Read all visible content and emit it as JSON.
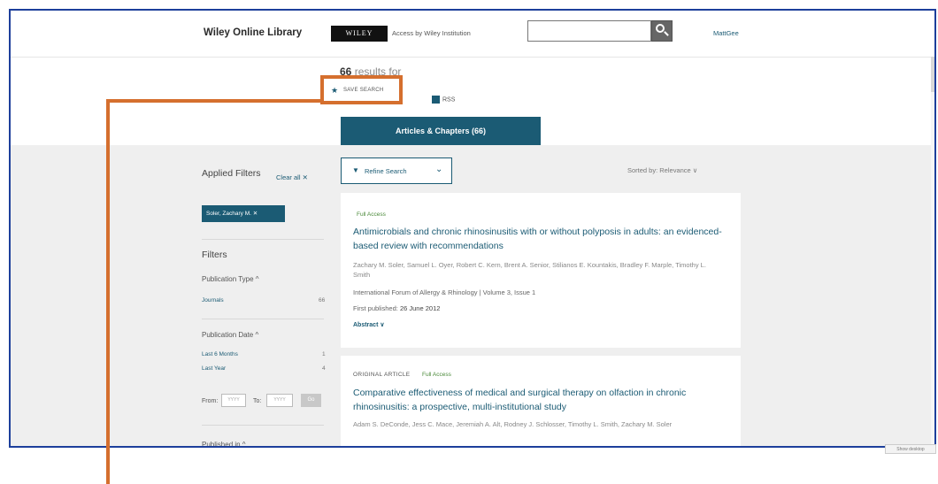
{
  "header": {
    "logo": "Wiley Online Library",
    "wiley_badge": "WILEY",
    "access_text": "Access by Wiley Institution",
    "search_placeholder": "",
    "user": "MattGee"
  },
  "results": {
    "count": "66",
    "label": " results for",
    "save_search": "SAVE SEARCH",
    "rss": "RSS",
    "tab": "Articles & Chapters (66)"
  },
  "sidebar": {
    "applied_filters": "Applied Filters",
    "clear_all": "Clear all ✕",
    "chip": "Soler, Zachary M. ✕",
    "filters": "Filters",
    "publication_type": "Publication Type ^",
    "journals": "Journals",
    "journals_count": "66",
    "publication_date": "Publication Date ^",
    "last6": "Last 6 Months",
    "last6_count": "1",
    "last_year": "Last Year",
    "last_year_count": "4",
    "from": "From:",
    "to": "To:",
    "from_placeholder": "YYYY",
    "to_placeholder": "YYYY",
    "go": "Go",
    "published_in": "Published in ^"
  },
  "toolbar": {
    "refine": "Refine Search",
    "sorted_by": "Sorted by: Relevance ∨"
  },
  "articles": [
    {
      "access": "Full Access",
      "title": "Antimicrobials and chronic rhinosinusitis with or without polyposis in adults: an evidenced-based review with recommendations",
      "authors": "Zachary M. Soler, Samuel L. Oyer, Robert C. Kern, Brent A. Senior, Stilianos E. Kountakis, Bradley F. Marple, Timothy L. Smith",
      "journal": "International Forum of Allergy & Rhinology | Volume 3, Issue 1",
      "first_published_label": "First published: ",
      "first_published_date": "26 June 2012",
      "abstract": "Abstract ∨"
    },
    {
      "type": "ORIGINAL ARTICLE",
      "access": "Full Access",
      "title": "Comparative effectiveness of medical and surgical therapy on olfaction in chronic rhinosinusitis: a prospective, multi-institutional study",
      "authors": "Adam S. DeConde, Jess C. Mace, Jeremiah A. Alt, Rodney J. Schlosser, Timothy L. Smith, Zachary M. Soler"
    }
  ],
  "footer": {
    "show_desktop": "Show desktop"
  },
  "colors": {
    "brand": "#1b5b74",
    "callout": "#d56f2e",
    "frame": "#1d3f9b",
    "access": "#4b8a3a"
  }
}
